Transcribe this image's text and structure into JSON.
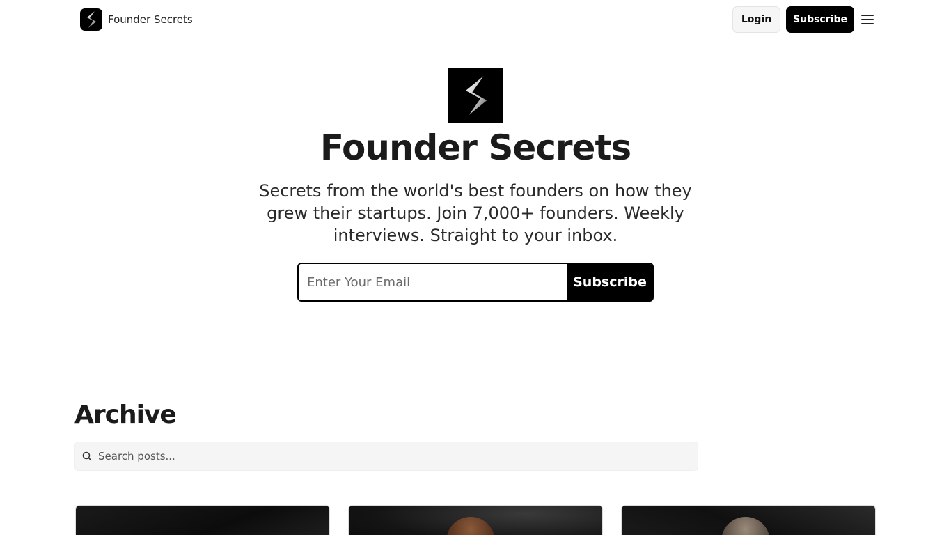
{
  "nav": {
    "brand_name": "Founder Secrets",
    "login_label": "Login",
    "subscribe_label": "Subscribe"
  },
  "hero": {
    "title": "Founder Secrets",
    "description": "Secrets from the world's best founders on how they grew their startups. Join 7,000+ founders. Weekly interviews. Straight to your inbox.",
    "email_placeholder": "Enter Your Email",
    "subscribe_label": "Subscribe"
  },
  "archive": {
    "title": "Archive",
    "search_placeholder": "Search posts..."
  },
  "colors": {
    "primary": "#000000",
    "background": "#ffffff",
    "search_bg": "#f5f5f6"
  },
  "icons": [
    "logo-icon",
    "menu-icon",
    "search-icon"
  ]
}
